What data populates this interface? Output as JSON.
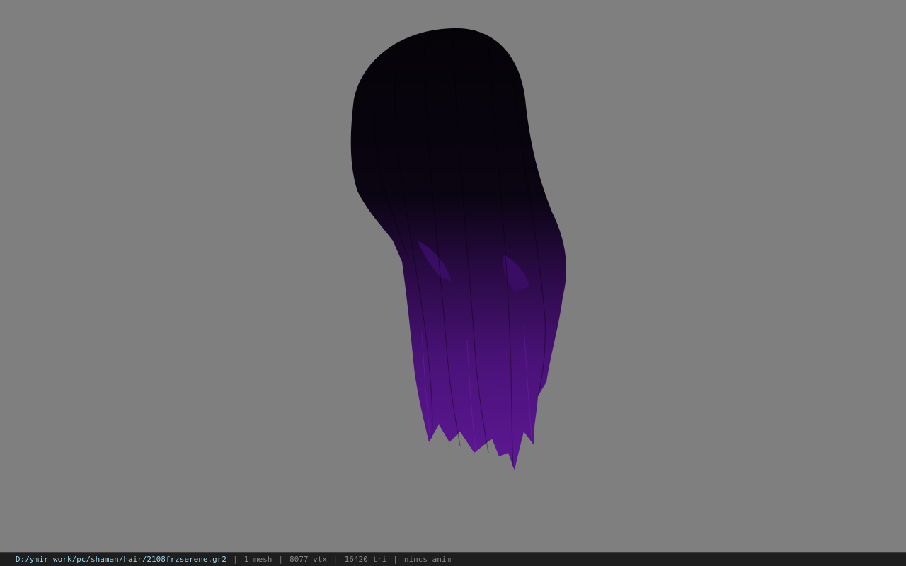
{
  "viewport": {
    "background_color": "#7f7f7f",
    "model_colors": {
      "root": "#050308",
      "tip": "#5a1690"
    }
  },
  "status_bar": {
    "file_path": "D:/ymir work/pc/shaman/hair/2108frzserene.gr2",
    "separator": "|",
    "mesh_count": "1 mesh",
    "vertex_count": "8077 vtx",
    "triangle_count": "16420 tri",
    "animation": "nincs anim"
  }
}
